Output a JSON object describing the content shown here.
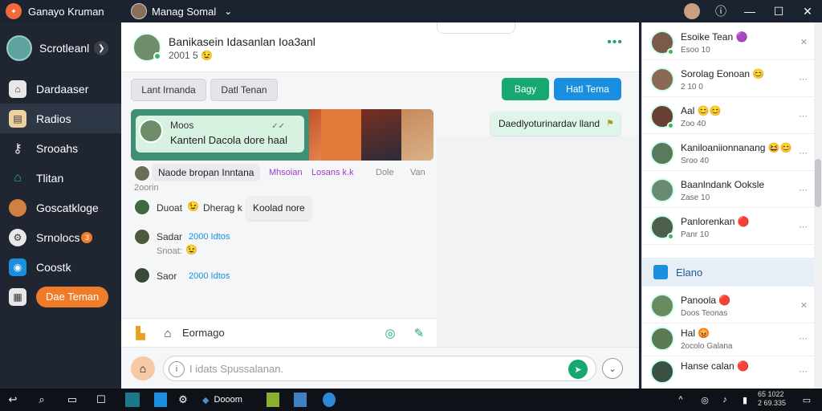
{
  "window": {
    "title": "Ganayo Kruman",
    "user_name": "Manag Somal",
    "controls": [
      "help-icon",
      "minimize-icon",
      "maximize-icon",
      "close-icon"
    ]
  },
  "sidebar": {
    "profile_name": "Scrotleanl",
    "items": [
      {
        "label": "Dardaaser",
        "icon": "home-icon",
        "color": "#e8e8e8"
      },
      {
        "label": "Radios",
        "icon": "archive-icon",
        "color": "#f0d0a0"
      },
      {
        "label": "Srooahs",
        "icon": "key-icon",
        "color": "#e8e8e8"
      },
      {
        "label": "Tlitan",
        "icon": "building-icon",
        "color": "#22b573"
      },
      {
        "label": "Goscatkloge",
        "icon": "user-icon",
        "color": "#d08040"
      },
      {
        "label": "Srnolocs",
        "icon": "settings-icon",
        "color": "#e8e8e8",
        "badge": "3"
      },
      {
        "label": "Coostk",
        "icon": "chat-icon",
        "color": "#1a8fe0"
      }
    ],
    "cta_label": "Dae Teman"
  },
  "chat": {
    "title": "Banikasein Idasanlan Ioa3anl",
    "subtitle": "2001 5",
    "subtitle_emoji": "😉",
    "chips_left": [
      "Lant Irnanda",
      "Datl Tenan"
    ],
    "chip_green": "Bagy",
    "chip_blue": "Hatl Tema",
    "card": {
      "line1": "Moos",
      "line2": "Kantenl Dacola dore haal"
    },
    "outgoing": "Daedlyoturinardav lland",
    "messages": [
      {
        "bubble": "Naode bropan Inntana",
        "time": "2oorin",
        "tags": [
          "Mhsoian",
          "Losans k.k",
          "Dole",
          "Van"
        ]
      },
      {
        "name": "Duoat",
        "emoji": "😉",
        "text": "Dherag k",
        "bubble": "Koolad nore"
      },
      {
        "name": "Sadar",
        "link": "2000 Idtos",
        "sub": "Snoat:",
        "emoji": "😉"
      },
      {
        "name": "Saor",
        "link": "2000 Idtos"
      }
    ],
    "toolbar_label": "Eormago",
    "composer_placeholder": "I idats Spussalanan."
  },
  "panel": {
    "items": [
      {
        "name": "Esoike Tean",
        "sub": "Esoo 10",
        "badge": "🟣",
        "avatar": "#7a5a48",
        "online": true
      },
      {
        "name": "Sorolag Eonoan",
        "sub": "2 10 0",
        "badge": "😊",
        "avatar": "#8a6a55",
        "online": false
      },
      {
        "name": "Aal",
        "sub": "Zoo 40",
        "badge": "😊😊",
        "avatar": "#6a4034",
        "online": true
      },
      {
        "name": "Kaniloaniionnanang",
        "sub": "Sroo 40",
        "badge": "😆😊",
        "avatar": "#5b7a5c",
        "online": false
      },
      {
        "name": "Baanlndank Ooksle",
        "sub": "Zase 10",
        "badge": "",
        "avatar": "#6a8a70",
        "online": false
      },
      {
        "name": "Panlorenkan",
        "sub": "Panr 10",
        "badge": "🔴",
        "avatar": "#4d5f48",
        "online": true
      }
    ],
    "section_label": "Elano",
    "items2": [
      {
        "name": "Panoola",
        "sub": "Doos Teonas",
        "badge": "🔴",
        "avatar": "#6a8a60"
      },
      {
        "name": "Hal",
        "sub": "2ocolo Galana",
        "badge": "😡",
        "avatar": "#5a7a52"
      },
      {
        "name": "Hanse calan",
        "sub": "",
        "badge": "🔴",
        "avatar": "#3a5040"
      }
    ]
  },
  "taskbar": {
    "app_label": "Dooom",
    "clock_line1": "65 1022",
    "clock_line2": "2 69.335"
  }
}
